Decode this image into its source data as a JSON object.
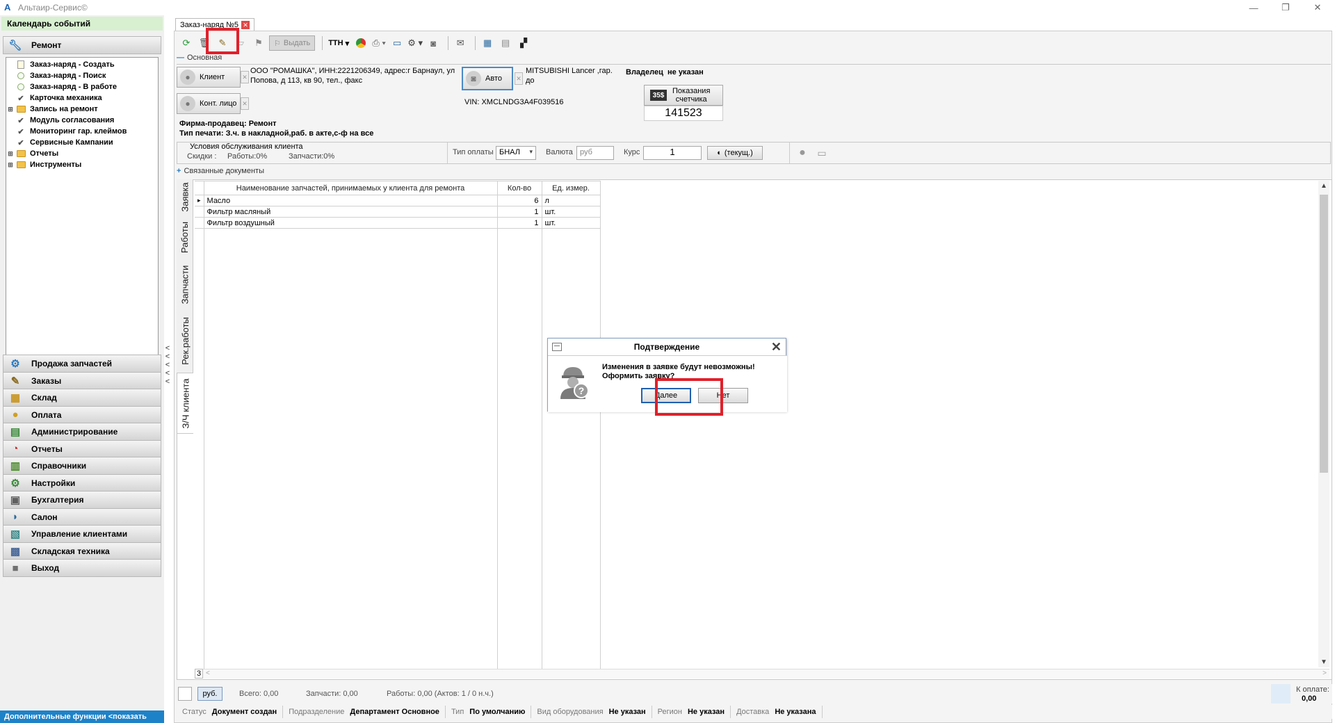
{
  "window": {
    "title": "Альтаир-Сервис©"
  },
  "left": {
    "calendar_header": "Календарь событий",
    "section_repair": "Ремонт",
    "tree": [
      {
        "label": "Заказ-наряд - Создать",
        "icon": "doc",
        "exp": ""
      },
      {
        "label": "Заказ-наряд - Поиск",
        "icon": "circle",
        "exp": ""
      },
      {
        "label": "Заказ-наряд - В работе",
        "icon": "circle",
        "exp": ""
      },
      {
        "label": "Карточка механика",
        "icon": "check",
        "exp": ""
      },
      {
        "label": "Запись на ремонт",
        "icon": "folder",
        "exp": "+"
      },
      {
        "label": "Модуль согласования",
        "icon": "check",
        "exp": ""
      },
      {
        "label": "Мониторинг гар. клеймов",
        "icon": "check",
        "exp": ""
      },
      {
        "label": "Сервисные Кампании",
        "icon": "check",
        "exp": ""
      },
      {
        "label": "Отчеты",
        "icon": "folder",
        "exp": "+"
      },
      {
        "label": "Инструменты",
        "icon": "folder",
        "exp": "+"
      }
    ],
    "nav": [
      {
        "label": "Продажа запчастей",
        "icon": "⚙",
        "color": "#2a7ac0"
      },
      {
        "label": "Заказы",
        "icon": "✎",
        "color": "#8a6a20"
      },
      {
        "label": "Склад",
        "icon": "▦",
        "color": "#c89520"
      },
      {
        "label": "Оплата",
        "icon": "●",
        "color": "#d0a020"
      },
      {
        "label": "Администрирование",
        "icon": "▤",
        "color": "#3a8a3a"
      },
      {
        "label": "Отчеты",
        "icon": "◔",
        "color": "#c03030"
      },
      {
        "label": "Справочники",
        "icon": "▥",
        "color": "#4a8a2a"
      },
      {
        "label": "Настройки",
        "icon": "⚙",
        "color": "#3a8a3a"
      },
      {
        "label": "Бухгалтерия",
        "icon": "▣",
        "color": "#606060"
      },
      {
        "label": "Салон",
        "icon": "◗",
        "color": "#2a6aa0"
      },
      {
        "label": "Управление клиентами",
        "icon": "▧",
        "color": "#3a8a8a"
      },
      {
        "label": "Складская техника",
        "icon": "▩",
        "color": "#4a6a9a"
      },
      {
        "label": "Выход",
        "icon": "■",
        "color": "#707070"
      }
    ],
    "extra": "Дополнительные функции <показать"
  },
  "tab": {
    "label": "Заказ-наряд №5"
  },
  "toolbar": {
    "issue_label": "Выдать",
    "ttn_label": "ТТН"
  },
  "form": {
    "section_main": "Основная",
    "client_label": "Клиент",
    "client_text": [
      "ООО \"РОМАШКА\", ИНН:2221206349, адрес:г Барнаул, ул",
      "Попова, д 113, кв 90, тел., факс"
    ],
    "contact_label": "Конт. лицо",
    "auto_label": "Авто",
    "auto_text": [
      "MITSUBISHI Lancer ,гар.",
      "до"
    ],
    "vin": "VIN: XMCLNDG3A4F039516",
    "owner_label": "Владелец",
    "owner_value": "не указан",
    "counter_label": [
      "Показания",
      "счетчика"
    ],
    "counter_value": "141523",
    "firm_line": "Фирма-продавец: Ремонт",
    "print_line": "Тип печати: З.ч. в накладной,раб. в акте,с-ф на все",
    "cond_title": "Условия обслуживания клиента",
    "cond_discounts": "Скидки :",
    "cond_works": "Работы:0%",
    "cond_parts": "Запчасти:0%",
    "pay_type_label": "Тип оплаты",
    "pay_type_value": "БНАЛ",
    "currency_label": "Валюта",
    "currency_value": "руб",
    "rate_label": "Курс",
    "rate_value": "1",
    "rate_btn": "(текущ.)",
    "section_related": "Связанные документы"
  },
  "vtabs": [
    "Заявка",
    "Работы",
    "Запчасти",
    "Рек.работы",
    "З/Ч клиента"
  ],
  "table": {
    "headers": [
      "Наименование запчастей, принимаемых у клиента для ремонта",
      "Кол-во",
      "Ед. измер."
    ],
    "rows": [
      [
        "Масло",
        "6",
        "л"
      ],
      [
        "Фильтр масляный",
        "1",
        "шт."
      ],
      [
        "Фильтр воздушный",
        "1",
        "шт."
      ]
    ],
    "row_count": "3"
  },
  "totals": {
    "currency": "руб.",
    "total": "Всего: 0,00",
    "parts": "Запчасти: 0,00",
    "works": "Работы: 0,00 (Актов: 1 / 0 н.ч.)",
    "to_pay_label": "К оплате:",
    "to_pay_value": "0,00"
  },
  "status": [
    {
      "label": "Статус",
      "value": "Документ создан"
    },
    {
      "label": "Подразделение",
      "value": "Департамент Основное"
    },
    {
      "label": "Тип",
      "value": "По умолчанию"
    },
    {
      "label": "Вид оборудования",
      "value": "Не указан"
    },
    {
      "label": "Регион",
      "value": "Не указан"
    },
    {
      "label": "Доставка",
      "value": "Не указана"
    }
  ],
  "dialog": {
    "title": "Подтверждение",
    "message_line1": "Изменения в заявке будут невозможны!",
    "message_line2": "Оформить заявку?",
    "ok_label": "Далее",
    "cancel_label": "Нет"
  },
  "colors": {
    "highlight": "#e0202a",
    "accent": "#1e82c8",
    "calendar_bg": "#d8f0d0"
  }
}
